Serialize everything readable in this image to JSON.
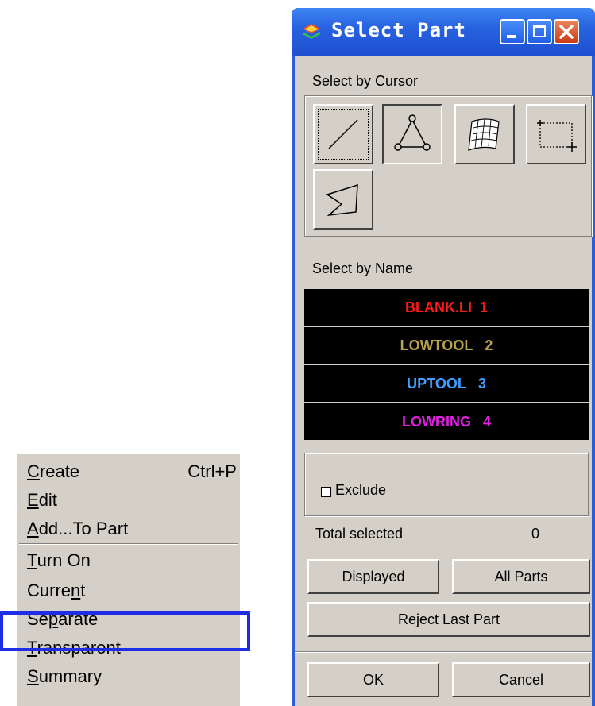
{
  "menu": {
    "items": [
      {
        "label": "Create",
        "shortcut": "Ctrl+P",
        "accel": "C"
      },
      {
        "label": "Edit",
        "shortcut": "",
        "accel": "E"
      },
      {
        "label": "Add...To Part",
        "shortcut": "",
        "accel": "A"
      },
      {
        "label": "Turn On",
        "shortcut": "",
        "accel": "T"
      },
      {
        "label": "Current",
        "shortcut": "",
        "accel": "n"
      },
      {
        "label": "Separate",
        "shortcut": "",
        "accel": "p"
      },
      {
        "label": "Transparent",
        "shortcut": "",
        "accel": "T"
      },
      {
        "label": "Summary",
        "shortcut": "",
        "accel": "S"
      }
    ],
    "highlighted_item": "Separate",
    "highlight_color": "#1f2ee6"
  },
  "dialog": {
    "title": "Select Part",
    "cursor_section_label": "Select by Cursor",
    "cursor_tools": [
      {
        "name": "line-select",
        "icon": "line-icon",
        "state": "focused"
      },
      {
        "name": "triangle-select",
        "icon": "triangle-icon",
        "state": "pressed"
      },
      {
        "name": "surface-select",
        "icon": "surface-mesh-icon",
        "state": "normal"
      },
      {
        "name": "rectangle-select",
        "icon": "rectangle-select-icon",
        "state": "normal"
      },
      {
        "name": "polygon-select",
        "icon": "polygon-icon",
        "state": "normal"
      }
    ],
    "name_section_label": "Select by Name",
    "parts": [
      {
        "name": "BLANK.LI",
        "id": "1",
        "color": "#ff1a1a"
      },
      {
        "name": "LOWTOOL",
        "id": "2",
        "color": "#b8a34a"
      },
      {
        "name": "UPTOOL",
        "id": "3",
        "color": "#3fa0ff"
      },
      {
        "name": "LOWRING",
        "id": "4",
        "color": "#e020e0"
      }
    ],
    "exclude_label": "Exclude",
    "exclude_checked": false,
    "total_selected_label": "Total selected",
    "total_selected_value": "0",
    "buttons": {
      "displayed": "Displayed",
      "all_parts": "All Parts",
      "reject_last": "Reject Last Part",
      "ok": "OK",
      "cancel": "Cancel"
    }
  }
}
